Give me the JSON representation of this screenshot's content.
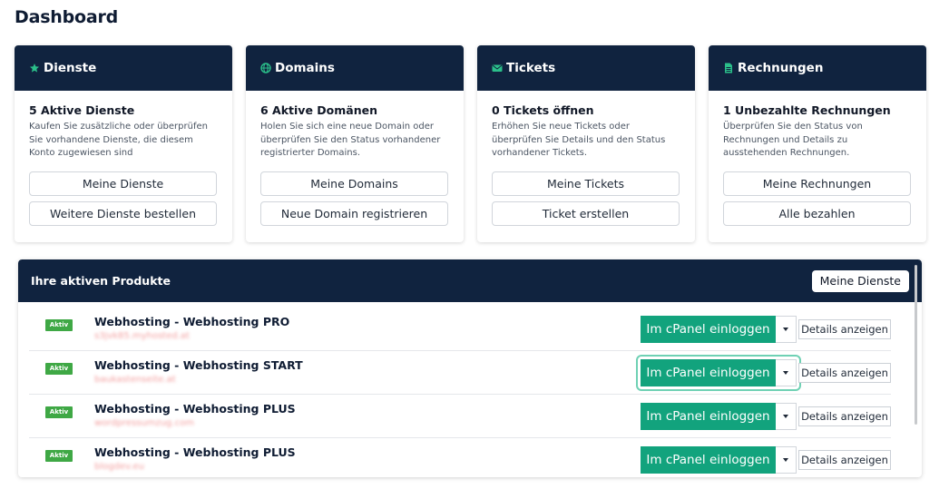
{
  "page": {
    "title": "Dashboard"
  },
  "cards": [
    {
      "header": "Dienste",
      "icon": "star-cube-icon",
      "title": "5 Aktive Dienste",
      "description": "Kaufen Sie zusätzliche oder überprüfen Sie vorhandene Dienste, die diesem Konto zugewiesen sind",
      "buttons": [
        "Meine Dienste",
        "Weitere Dienste bestellen"
      ]
    },
    {
      "header": "Domains",
      "icon": "globe-icon",
      "title": "6 Aktive Domänen",
      "description": "Holen Sie sich eine neue Domain oder überprüfen Sie den Status vorhandener registrierter Domains.",
      "buttons": [
        "Meine Domains",
        "Neue Domain registrieren"
      ]
    },
    {
      "header": "Tickets",
      "icon": "envelope-icon",
      "title": "0 Tickets öffnen",
      "description": "Erhöhen Sie neue Tickets oder überprüfen Sie Details und den Status vorhandener Tickets.",
      "buttons": [
        "Meine Tickets",
        "Ticket erstellen"
      ]
    },
    {
      "header": "Rechnungen",
      "icon": "document-icon",
      "title": "1 Unbezahlte Rechnungen",
      "description": "Überprüfen Sie den Status von Rechnungen und Details zu ausstehenden Rechnungen.",
      "buttons": [
        "Meine Rechnungen",
        "Alle bezahlen"
      ]
    }
  ],
  "products": {
    "title": "Ihre aktiven Produkte",
    "header_button": "Meine Dienste",
    "login_label": "Im cPanel einloggen",
    "details_label": "Details anzeigen",
    "items": [
      {
        "status": "Aktiv",
        "name": "Webhosting - Webhosting PRO",
        "domain": "s3jvk85.myhosted.at"
      },
      {
        "status": "Aktiv",
        "name": "Webhosting - Webhosting START",
        "domain": "baukastenseite.at"
      },
      {
        "status": "Aktiv",
        "name": "Webhosting - Webhosting PLUS",
        "domain": "wordpressumzug.com"
      },
      {
        "status": "Aktiv",
        "name": "Webhosting - Webhosting PLUS",
        "domain": "blogdev.eu"
      }
    ]
  },
  "colors": {
    "navy": "#10233f",
    "accent_green": "#12a37d",
    "badge_green": "#3fa845",
    "icon_green": "#2bbf8a"
  }
}
